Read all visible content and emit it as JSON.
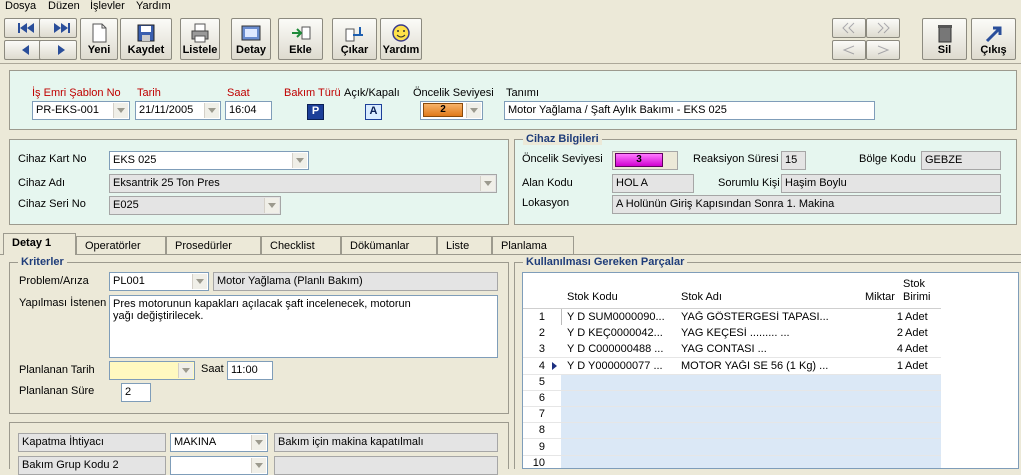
{
  "menu": [
    "Dosya",
    "Düzen",
    "İşlevler",
    "Yardım"
  ],
  "toolbar": {
    "yeni": "Yeni",
    "kaydet": "Kaydet",
    "listele": "Listele",
    "detay": "Detay",
    "ekle": "Ekle",
    "cikar": "Çıkar",
    "yardim": "Yardım",
    "sil": "Sil",
    "cikis": "Çıkış"
  },
  "header": {
    "sablon_label": "İş Emri Şablon No",
    "sablon_value": "PR-EKS-001",
    "tarih_label": "Tarih",
    "tarih_value": "21/11/2005",
    "saat_label": "Saat",
    "saat_value": "16:04",
    "bakim_label": "Bakım Türü",
    "bakim_value": "P",
    "acik_label": "Açık/Kapalı",
    "acik_value": "A",
    "oncelik_label": "Öncelik Seviyesi",
    "oncelik_value": "2",
    "tanim_label": "Tanımı",
    "tanim_value": "Motor Yağlama / Şaft Aylık Bakımı - EKS 025"
  },
  "device": {
    "kart_label": "Cihaz Kart No",
    "kart_value": "EKS 025",
    "adi_label": "Cihaz Adı",
    "adi_value": "Eksantrik 25 Ton Pres",
    "seri_label": "Cihaz Seri No",
    "seri_value": "E025"
  },
  "info": {
    "title": "Cihaz Bilgileri",
    "oncelik_label": "Öncelik Seviyesi",
    "oncelik_value": "3",
    "reaksiyon_label": "Reaksiyon Süresi",
    "reaksiyon_value": "15",
    "bolge_label": "Bölge Kodu",
    "bolge_value": "GEBZE",
    "alan_label": "Alan Kodu",
    "alan_value": "HOL A",
    "sorumlu_label": "Sorumlu Kişi",
    "sorumlu_value": "Haşim Boylu",
    "lokasyon_label": "Lokasyon",
    "lokasyon_value": "A Holünün Giriş Kapısından Sonra 1. Makina"
  },
  "tabs": [
    "Detay 1",
    "Operatörler",
    "Prosedürler",
    "Checklist",
    "Dökümanlar",
    "Liste",
    "Planlama"
  ],
  "criteria": {
    "title": "Kriterler",
    "problem_label": "Problem/Arıza",
    "problem_code": "PL001",
    "problem_desc": "Motor Yağlama (Planlı Bakım)",
    "yapilmasi_label": "Yapılması İstenen",
    "yapilmasi_line1": "Pres motorunun kapakları açılacak şaft incelenecek, motorun",
    "yapilmasi_line2": "yağı değiştirilecek.",
    "plan_tarih_label": "Planlanan Tarih",
    "plan_tarih_value": "",
    "saat_label": "Saat",
    "saat_value": "11:00",
    "plan_sure_label": "Planlanan Süre",
    "plan_sure_value": "2"
  },
  "bottom": {
    "kapatma_label": "Kapatma İhtiyacı",
    "kapatma_value": "MAKINA",
    "kapatma_desc": "Bakım için makina kapatılmalı",
    "grup_label": "Bakım Grup Kodu 2"
  },
  "parts": {
    "title": "Kullanılması Gereken Parçalar",
    "col_kod": "Stok Kodu",
    "col_adi": "Stok Adı",
    "col_miktar": "Miktar",
    "col_birim1": "Stok",
    "col_birim2": "Birimi",
    "rows": [
      {
        "n": "1",
        "kod": "Y D SUM0000090...",
        "adi": "YAĞ GÖSTERGESİ    TAPASI...",
        "miktar": "1",
        "birim": "Adet"
      },
      {
        "n": "2",
        "kod": "Y D KEÇ0000042...",
        "adi": "YAG KEÇESİ  .........          ...",
        "miktar": "2",
        "birim": "Adet"
      },
      {
        "n": "3",
        "kod": "Y D C000000488  ...",
        "adi": "YAG CONTASI                      ...",
        "miktar": "4",
        "birim": "Adet"
      },
      {
        "n": "4",
        "kod": "Y D Y000000077  ...",
        "adi": "MOTOR YAĞI SE 56 (1 Kg)  ...",
        "miktar": "1",
        "birim": "Adet"
      },
      {
        "n": "5",
        "kod": "",
        "adi": "",
        "miktar": "",
        "birim": ""
      },
      {
        "n": "6",
        "kod": "",
        "adi": "",
        "miktar": "",
        "birim": ""
      },
      {
        "n": "7",
        "kod": "",
        "adi": "",
        "miktar": "",
        "birim": ""
      },
      {
        "n": "8",
        "kod": "",
        "adi": "",
        "miktar": "",
        "birim": ""
      },
      {
        "n": "9",
        "kod": "",
        "adi": "",
        "miktar": "",
        "birim": ""
      },
      {
        "n": "10",
        "kod": "",
        "adi": "",
        "miktar": "",
        "birim": ""
      }
    ]
  }
}
